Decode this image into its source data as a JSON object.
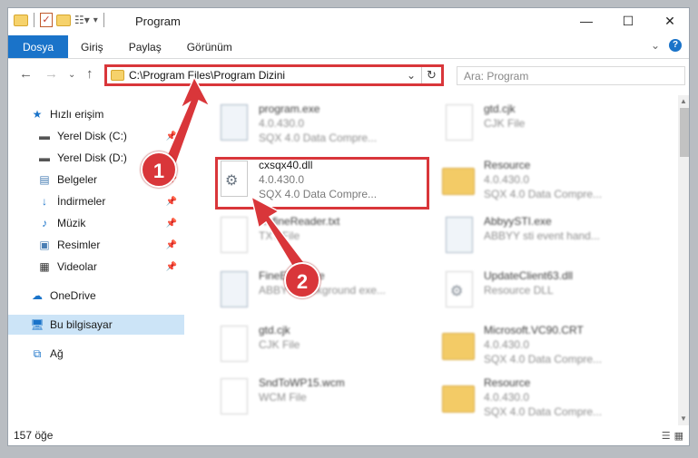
{
  "window": {
    "title": "Program",
    "controls": {
      "minimize": "—",
      "maximize": "☐",
      "close": "✕"
    }
  },
  "ribbon": {
    "tabs": [
      "Dosya",
      "Giriş",
      "Paylaş",
      "Görünüm"
    ],
    "expand_icon": "chevron-down-icon",
    "help_icon": "?"
  },
  "nav": {
    "address": "C:\\Program Files\\Program Dizini",
    "search_placeholder": "Ara: Program"
  },
  "sidebar": {
    "items": [
      {
        "label": "Hızlı erişim",
        "icon": "star-icon",
        "pinned": false
      },
      {
        "label": "Yerel Disk (C:)",
        "icon": "drive-icon",
        "pinned": true
      },
      {
        "label": "Yerel Disk (D:)",
        "icon": "drive-icon",
        "pinned": true
      },
      {
        "label": "Belgeler",
        "icon": "documents-icon",
        "pinned": true
      },
      {
        "label": "İndirmeler",
        "icon": "download-icon",
        "pinned": true
      },
      {
        "label": "Müzik",
        "icon": "music-icon",
        "pinned": true
      },
      {
        "label": "Resimler",
        "icon": "pictures-icon",
        "pinned": true
      },
      {
        "label": "Videolar",
        "icon": "video-icon",
        "pinned": true
      },
      {
        "label": "OneDrive",
        "icon": "cloud-icon",
        "pinned": false
      },
      {
        "label": "Bu bilgisayar",
        "icon": "computer-icon",
        "pinned": false
      },
      {
        "label": "Ağ",
        "icon": "network-icon",
        "pinned": false
      }
    ]
  },
  "files": [
    {
      "name": "program.exe",
      "line1": "4.0.430.0",
      "line2": "SQX 4.0 Data Compre...",
      "icon": "exe-file-icon"
    },
    {
      "name": "gtd.cjk",
      "line1": "CJK File",
      "line2": "",
      "icon": "generic-file-icon"
    },
    {
      "name": "cxsqx40.dll",
      "line1": "4.0.430.0",
      "line2": "SQX 4.0 Data Compre...",
      "icon": "dll-file-icon"
    },
    {
      "name": "Resource",
      "line1": "4.0.430.0",
      "line2": "SQX 4.0 Data Compre...",
      "icon": "folder-icon"
    },
    {
      "name": "RefineReader.txt",
      "line1": "TXT File",
      "line2": "",
      "icon": "text-file-icon"
    },
    {
      "name": "AbbyySTI.exe",
      "line1": "ABBYY sti event hand...",
      "line2": "",
      "icon": "exe-file-icon"
    },
    {
      "name": "FineExec.exe",
      "line1": "ABBYY Background exe...",
      "line2": "",
      "icon": "exe-file-icon"
    },
    {
      "name": "UpdateClient63.dll",
      "line1": "Resource DLL",
      "line2": "",
      "icon": "dll-file-icon"
    },
    {
      "name": "gtd.cjk",
      "line1": "CJK File",
      "line2": "",
      "icon": "generic-file-icon"
    },
    {
      "name": "Microsoft.VC90.CRT",
      "line1": "4.0.430.0",
      "line2": "SQX 4.0 Data Compre...",
      "icon": "folder-icon"
    },
    {
      "name": "SndToWP15.wcm",
      "line1": "WCM File",
      "line2": "",
      "icon": "generic-file-icon"
    },
    {
      "name": "Resource",
      "line1": "4.0.430.0",
      "line2": "SQX 4.0 Data Compre...",
      "icon": "folder-icon"
    }
  ],
  "status": {
    "count": "157 öğe"
  },
  "annotations": {
    "callout1": "1",
    "callout2": "2"
  },
  "colors": {
    "accent": "#1a73c9",
    "highlight": "#d9363a",
    "selected": "#cce4f7"
  }
}
